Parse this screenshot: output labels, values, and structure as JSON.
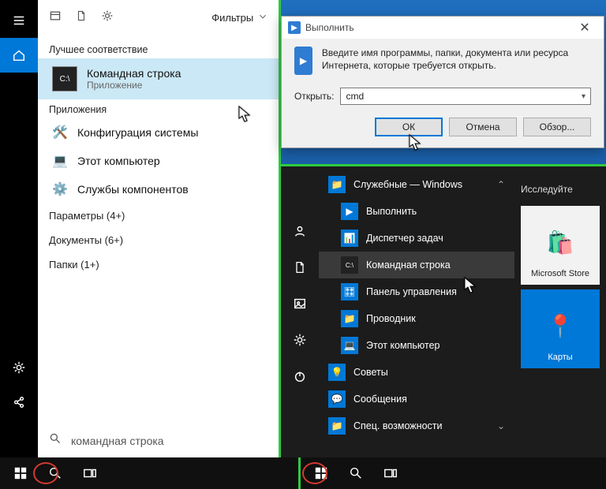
{
  "left": {
    "filters_label": "Фильтры",
    "best_match_header": "Лучшее соответствие",
    "best_match": {
      "title": "Командная строка",
      "subtitle": "Приложение"
    },
    "apps_header": "Приложения",
    "apps": [
      {
        "title": "Конфигурация системы"
      },
      {
        "title": "Этот компьютер"
      },
      {
        "title": "Службы компонентов"
      }
    ],
    "params": "Параметры (4+)",
    "documents": "Документы (6+)",
    "folders": "Папки (1+)",
    "search_text": "командная строка",
    "typed_prefix": "ко"
  },
  "run": {
    "title": "Выполнить",
    "desc": "Введите имя программы, папки, документа или ресурса Интернета, которые требуется открыть.",
    "open_label": "Открыть:",
    "value": "cmd",
    "ok": "ОК",
    "cancel": "Отмена",
    "browse": "Обзор..."
  },
  "start": {
    "group_label": "Служебные — Windows",
    "items": [
      "Выполнить",
      "Диспетчер задач",
      "Командная строка",
      "Панель управления",
      "Проводник",
      "Этот компьютер"
    ],
    "extra_items": [
      "Советы",
      "Сообщения",
      "Спец. возможности"
    ],
    "explore_label": "Исследуйте",
    "tile_store": "Microsoft Store",
    "tile_maps": "Карты"
  },
  "icons": {
    "hamburger": "hamburger",
    "home": "home",
    "gear": "gear",
    "share": "share",
    "window": "window",
    "page": "page",
    "search": "search",
    "chevron_down": "chevron",
    "start": "start",
    "taskview": "taskview",
    "account": "account",
    "docs": "docs",
    "pics": "pics",
    "power": "power",
    "folder": "folder",
    "bulb": "bulb",
    "chat": "chat",
    "close": "close",
    "cmd_glyph": "C:\\",
    "store_bag": "🛍",
    "map_pin": "📍"
  }
}
